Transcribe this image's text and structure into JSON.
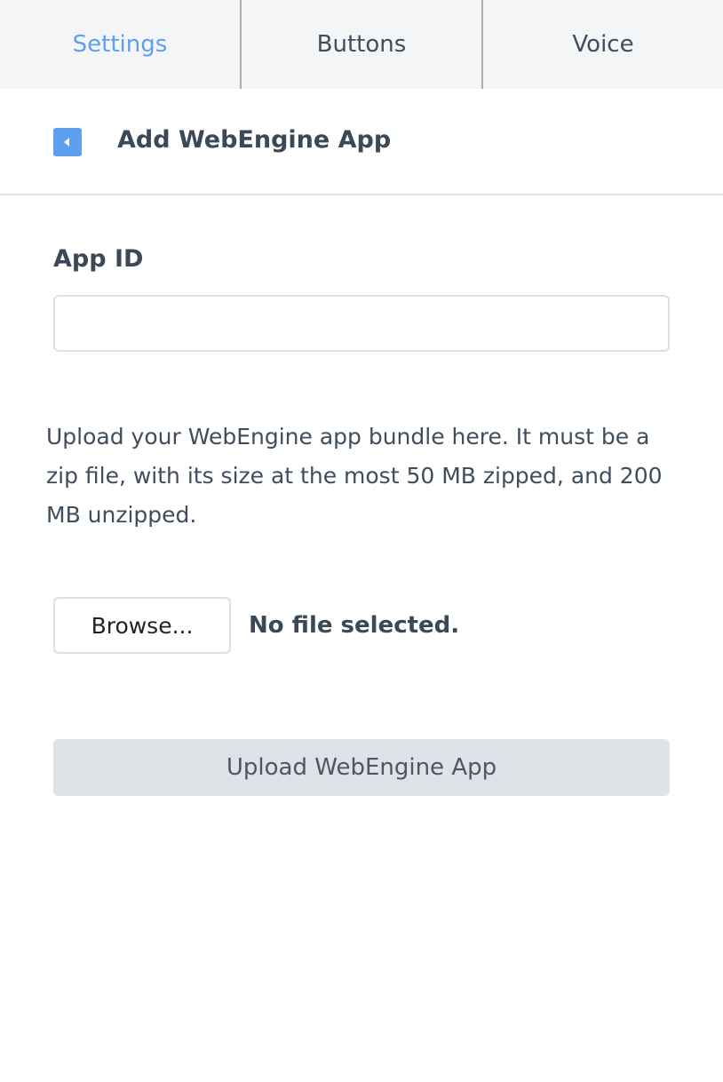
{
  "tabs": [
    {
      "label": "Settings",
      "active": true
    },
    {
      "label": "Buttons",
      "active": false
    },
    {
      "label": "Voice",
      "active": false
    }
  ],
  "subheader": {
    "back_icon": "caret-left-icon",
    "title": "Add WebEngine App"
  },
  "form": {
    "app_id_label": "App ID",
    "app_id_value": "",
    "app_id_placeholder": "",
    "description": "Upload your WebEngine app bundle here. It must be a zip file, with its size at the most 50 MB zipped, and 200 MB unzipped.",
    "browse_label": "Browse...",
    "file_status": "No file selected.",
    "upload_label": "Upload WebEngine App"
  },
  "colors": {
    "accent": "#5ea0f0",
    "tab_bar_bg": "#f4f5f7",
    "upload_button_bg": "#dfe2e7",
    "text": "#3a4857"
  }
}
